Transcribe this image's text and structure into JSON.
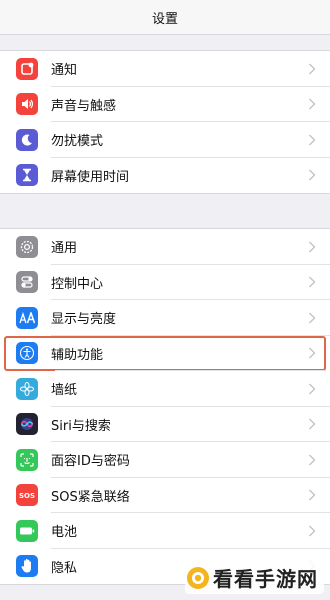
{
  "header": {
    "title": "设置"
  },
  "group1": [
    {
      "label": "通知",
      "icon": "notification-icon",
      "color": "#f4433c"
    },
    {
      "label": "声音与触感",
      "icon": "sound-icon",
      "color": "#f4433c"
    },
    {
      "label": "勿扰模式",
      "icon": "moon-icon",
      "color": "#5b5bd6"
    },
    {
      "label": "屏幕使用时间",
      "icon": "hourglass-icon",
      "color": "#5b5bd6"
    }
  ],
  "group2": [
    {
      "label": "通用",
      "icon": "gear-icon",
      "color": "#8e8e93"
    },
    {
      "label": "控制中心",
      "icon": "toggles-icon",
      "color": "#8e8e93"
    },
    {
      "label": "显示与亮度",
      "icon": "text-size-icon",
      "color": "#1e7cf2"
    },
    {
      "label": "辅助功能",
      "icon": "accessibility-icon",
      "color": "#1e7cf2",
      "highlighted": true
    },
    {
      "label": "墙纸",
      "icon": "flower-icon",
      "color": "#35aadc"
    },
    {
      "label": "Siri与搜索",
      "icon": "siri-icon",
      "color": "#222233"
    },
    {
      "label": "面容ID与密码",
      "icon": "face-id-icon",
      "color": "#34c759"
    },
    {
      "label": "SOS紧急联络",
      "icon": "sos-icon",
      "color": "#f4433c"
    },
    {
      "label": "电池",
      "icon": "battery-icon",
      "color": "#34c759"
    },
    {
      "label": "隐私",
      "icon": "hand-icon",
      "color": "#1e7cf2"
    }
  ],
  "watermark": {
    "text": "看看手游网"
  }
}
